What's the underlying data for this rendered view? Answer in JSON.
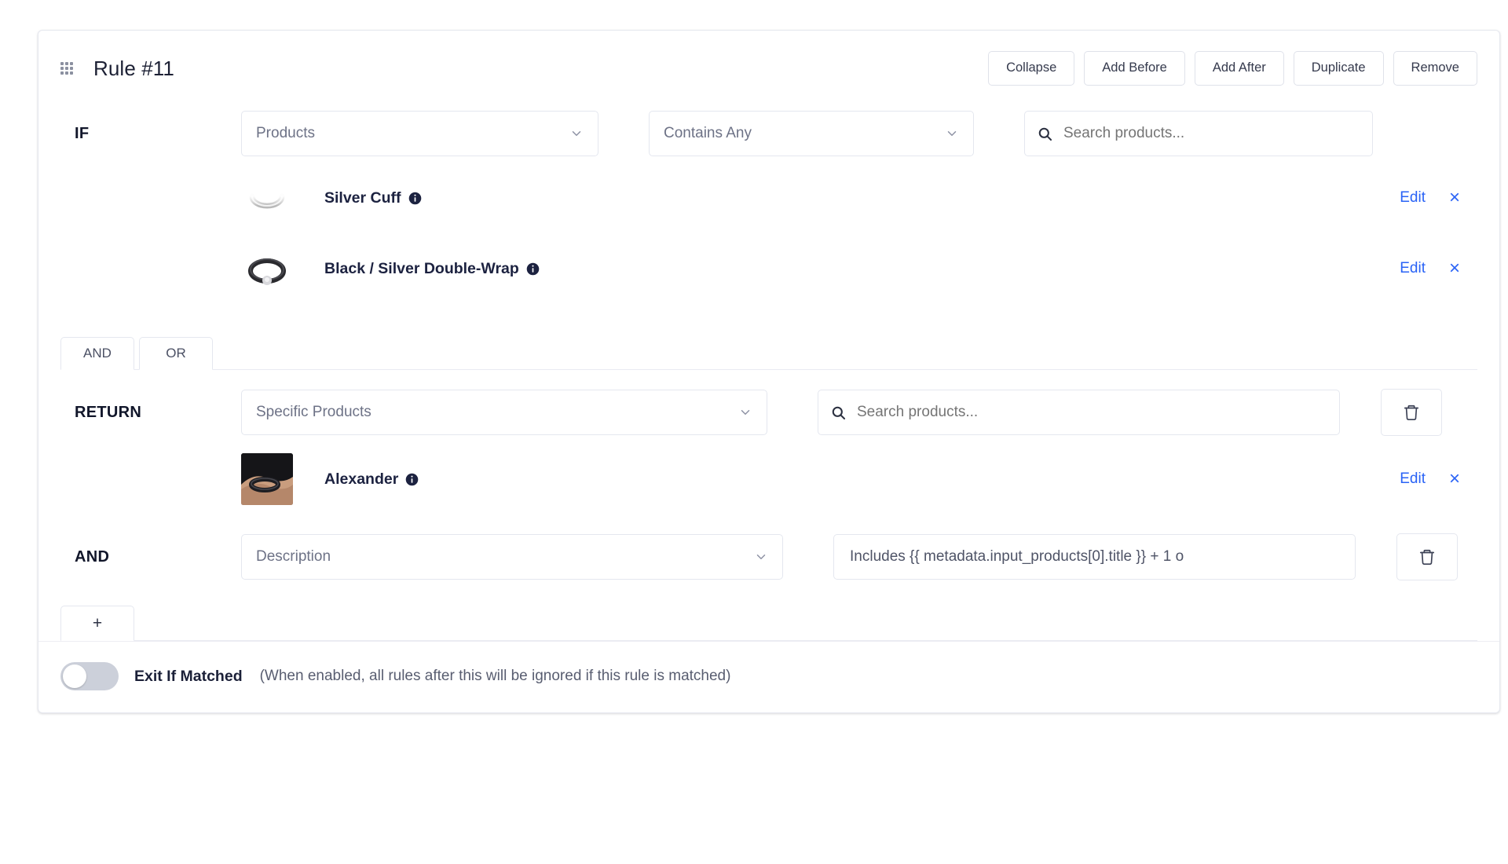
{
  "header": {
    "drag_handle_icon": "drag-grid-icon",
    "title": "Rule #11",
    "actions": [
      {
        "label": "Collapse",
        "name": "collapse-button"
      },
      {
        "label": "Add Before",
        "name": "add-before-button"
      },
      {
        "label": "Add After",
        "name": "add-after-button"
      },
      {
        "label": "Duplicate",
        "name": "duplicate-button"
      },
      {
        "label": "Remove",
        "name": "remove-button"
      }
    ]
  },
  "if_section": {
    "label": "IF",
    "field_select": {
      "value": "Products",
      "icon": "chevron-down-icon"
    },
    "operator_select": {
      "value": "Contains Any",
      "icon": "chevron-down-icon"
    },
    "search": {
      "placeholder": "Search products...",
      "value": "",
      "icon": "search-icon"
    },
    "products": [
      {
        "name": "Silver Cuff",
        "info_icon": "info-icon",
        "thumbnail": "silver-cuff-bracelet",
        "edit_label": "Edit",
        "remove_label": "×"
      },
      {
        "name": "Black / Silver Double-Wrap",
        "info_icon": "info-icon",
        "thumbnail": "black-silver-wrap-bracelet",
        "edit_label": "Edit",
        "remove_label": "×"
      }
    ]
  },
  "logic_tabs": [
    {
      "label": "AND",
      "name": "tab-and"
    },
    {
      "label": "OR",
      "name": "tab-or"
    }
  ],
  "return_section": {
    "label": "RETURN",
    "type_select": {
      "value": "Specific Products",
      "icon": "chevron-down-icon"
    },
    "search": {
      "placeholder": "Search products...",
      "value": "",
      "icon": "search-icon"
    },
    "delete_icon": "trash-icon",
    "products": [
      {
        "name": "Alexander",
        "info_icon": "info-icon",
        "thumbnail": "alexander-wrist-photo",
        "edit_label": "Edit",
        "remove_label": "×"
      }
    ]
  },
  "and_section": {
    "label": "AND",
    "field_select": {
      "value": "Description",
      "icon": "chevron-down-icon"
    },
    "value_input": {
      "value": "Includes {{ metadata.input_products[0].title }} + 1 o"
    },
    "delete_icon": "trash-icon"
  },
  "add_row": {
    "label": "+",
    "name": "add-condition-button"
  },
  "footer": {
    "toggle": {
      "enabled": false
    },
    "label": "Exit If Matched",
    "hint": "(When enabled, all rules after this will be ignored if this rule is matched)"
  },
  "colors": {
    "link": "#2a63f6",
    "border": "#e4e7ef",
    "text_dark": "#1c2034",
    "text_muted": "#6d7286",
    "toggle_off": "#ccd0da"
  }
}
